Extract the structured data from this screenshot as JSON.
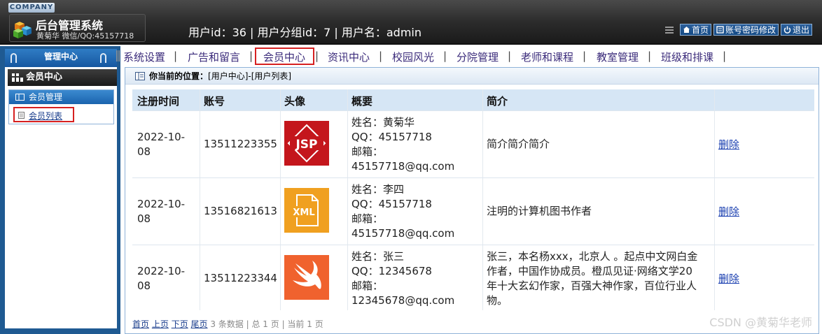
{
  "header": {
    "company": "COMPANY",
    "title": "后台管理系统",
    "subtitle": "黄菊华 微信/QQ:45157718",
    "user_info": "用户id：36 | 用户分组id：7 | 用户名：admin",
    "home_label": "首页",
    "password_label": "账号密码修改",
    "logout_label": "退出"
  },
  "sidebar": {
    "panel_title": "管理中心",
    "section_title": "会员中心",
    "group_title": "会员管理",
    "group_item": "会员列表"
  },
  "nav": {
    "items": [
      "系统设置",
      "广告和留言",
      "会员中心",
      "资讯中心",
      "校园风光",
      "分院管理",
      "老师和课程",
      "教室管理",
      "班级和排课"
    ],
    "active": "会员中心",
    "separator": "|"
  },
  "breadcrumb": {
    "label": "你当前的位置：",
    "path": "[用户中心]-[用户列表]"
  },
  "table": {
    "columns": [
      "注册时间",
      "账号",
      "头像",
      "概要",
      "简介",
      ""
    ],
    "rows": [
      {
        "date_line1": "2022-10-",
        "date_line2": "08",
        "account": "13511223355",
        "avatar": "JSP",
        "name": "姓名：黄菊华",
        "qq": "QQ：45157718",
        "email_label": "邮箱：",
        "email": "45157718@qq.com",
        "intro": "简介简介简介",
        "action": "删除"
      },
      {
        "date_line1": "2022-10-",
        "date_line2": "08",
        "account": "13516821613",
        "avatar": "XML",
        "name": "姓名：李四",
        "qq": "QQ：45157718",
        "email_label": "邮箱：",
        "email": "45157718@qq.com",
        "intro": "注明的计算机图书作者",
        "action": "删除"
      },
      {
        "date_line1": "2022-10-",
        "date_line2": "08",
        "account": "13511223344",
        "avatar": "swift-icon",
        "name": "姓名：张三",
        "qq": "QQ：12345678",
        "email_label": "邮箱：",
        "email": "12345678@qq.com",
        "intro_lines": [
          "张三，本名杨xxx，北京人 。起点中文网白金",
          "作者，中国作协成员。橙瓜见证·网络文学20",
          "年十大玄幻作家，百强大神作家，百位行业人",
          "物。"
        ],
        "action": "删除"
      }
    ]
  },
  "pager": {
    "first": "首页",
    "prev": "上页",
    "next": "下页",
    "last": "尾页",
    "summary": "3 条数据 | 总 1 页 | 当前 1 页"
  },
  "watermark": "CSDN @黄菊华老师",
  "colors": {
    "accent_blue": "#1f5a92",
    "highlight_red": "#d62020",
    "header_bg": "#2c2c2c",
    "table_head_bg": "#d6e6f5"
  }
}
